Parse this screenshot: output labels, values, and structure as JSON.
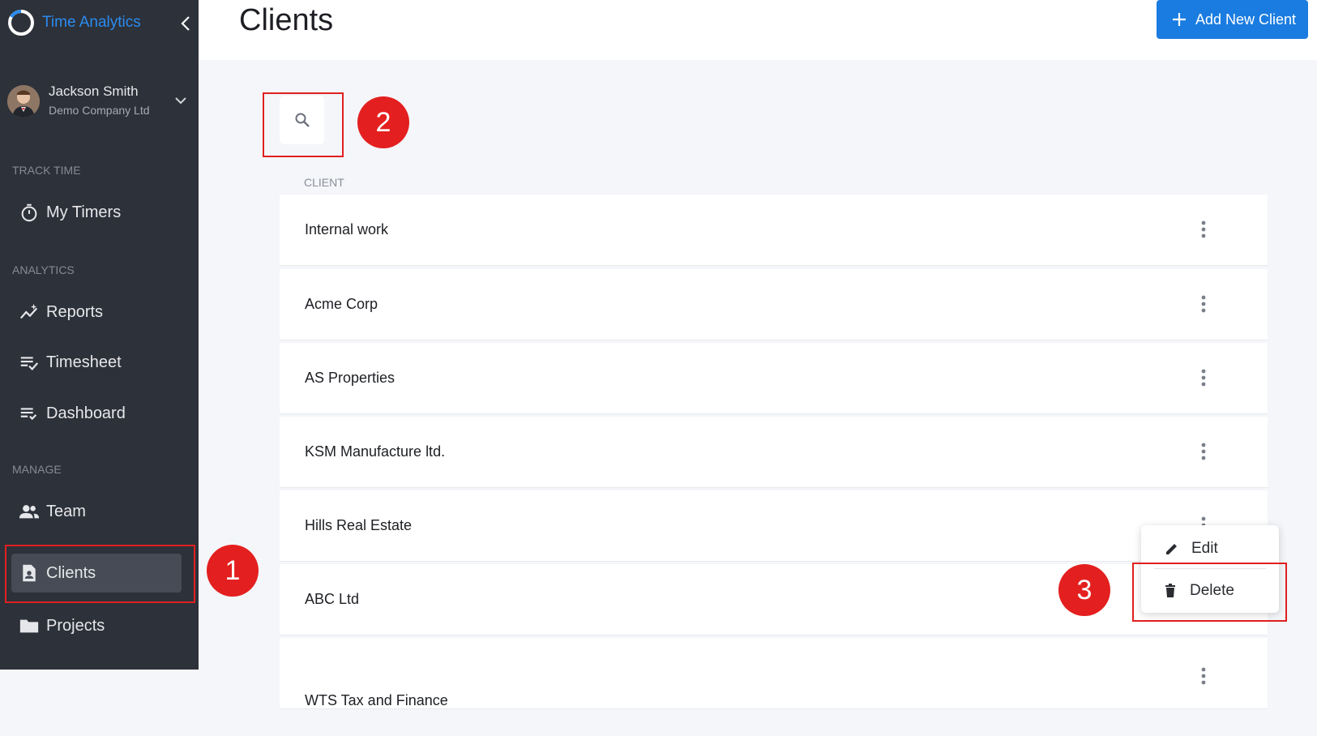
{
  "app": {
    "name": "Time Analytics"
  },
  "user": {
    "name": "Jackson Smith",
    "company": "Demo Company Ltd"
  },
  "sidebar": {
    "sections": [
      {
        "label": "TRACK TIME"
      },
      {
        "label": "ANALYTICS"
      },
      {
        "label": "MANAGE"
      }
    ],
    "items": [
      {
        "label": "My Timers",
        "icon": "stopwatch-icon"
      },
      {
        "label": "Reports",
        "icon": "analytics-icon"
      },
      {
        "label": "Timesheet",
        "icon": "checklist-icon"
      },
      {
        "label": "Dashboard",
        "icon": "list-check-icon"
      },
      {
        "label": "Team",
        "icon": "people-icon"
      },
      {
        "label": "Clients",
        "icon": "contact-card-icon",
        "active": true
      },
      {
        "label": "Projects",
        "icon": "folder-icon"
      }
    ]
  },
  "header": {
    "title": "Clients",
    "add_button": "Add New Client"
  },
  "table": {
    "column": "CLIENT",
    "rows": [
      "Internal work",
      "Acme Corp",
      "AS Properties",
      "KSM Manufacture ltd.",
      "Hills Real Estate",
      "ABC Ltd",
      "WTS Tax and Finance"
    ]
  },
  "context_menu": {
    "edit": "Edit",
    "delete": "Delete"
  },
  "annotations": {
    "one": "1",
    "two": "2",
    "three": "3"
  },
  "colors": {
    "sidebar": "#2d3139",
    "accent": "#1a7ce0",
    "annotation": "#e41f1f"
  }
}
